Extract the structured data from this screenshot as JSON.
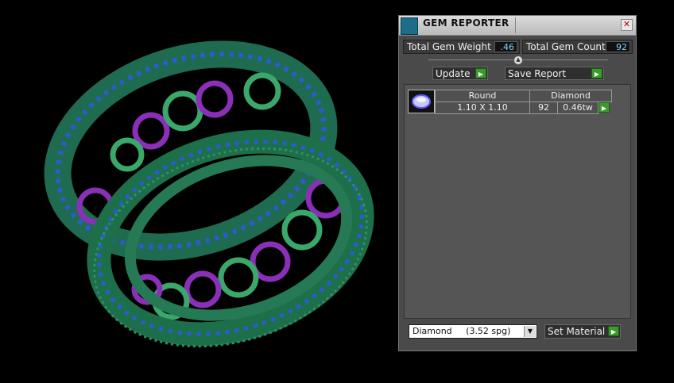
{
  "viewport": {
    "description_icon": "ring-3d-model"
  },
  "panel": {
    "title": "GEM REPORTER",
    "close_icon": "close-icon",
    "total_weight_label": "Total Gem Weight",
    "total_weight_value": ".46",
    "total_count_label": "Total Gem Count",
    "total_count_value": "92",
    "update_label": "Update",
    "save_report_label": "Save Report"
  },
  "gems": [
    {
      "shape": "Round",
      "material": "Diamond",
      "size": "1.10 X 1.10",
      "count": "92",
      "weight": "0.46tw"
    }
  ],
  "material_select": {
    "value": "Diamond     (3.52 spg)"
  },
  "set_material_label": "Set Material",
  "colors": {
    "accent_green": "#3a9a2a",
    "value_blue": "#7fd4ff",
    "panel_bg": "#4a4a4a"
  }
}
